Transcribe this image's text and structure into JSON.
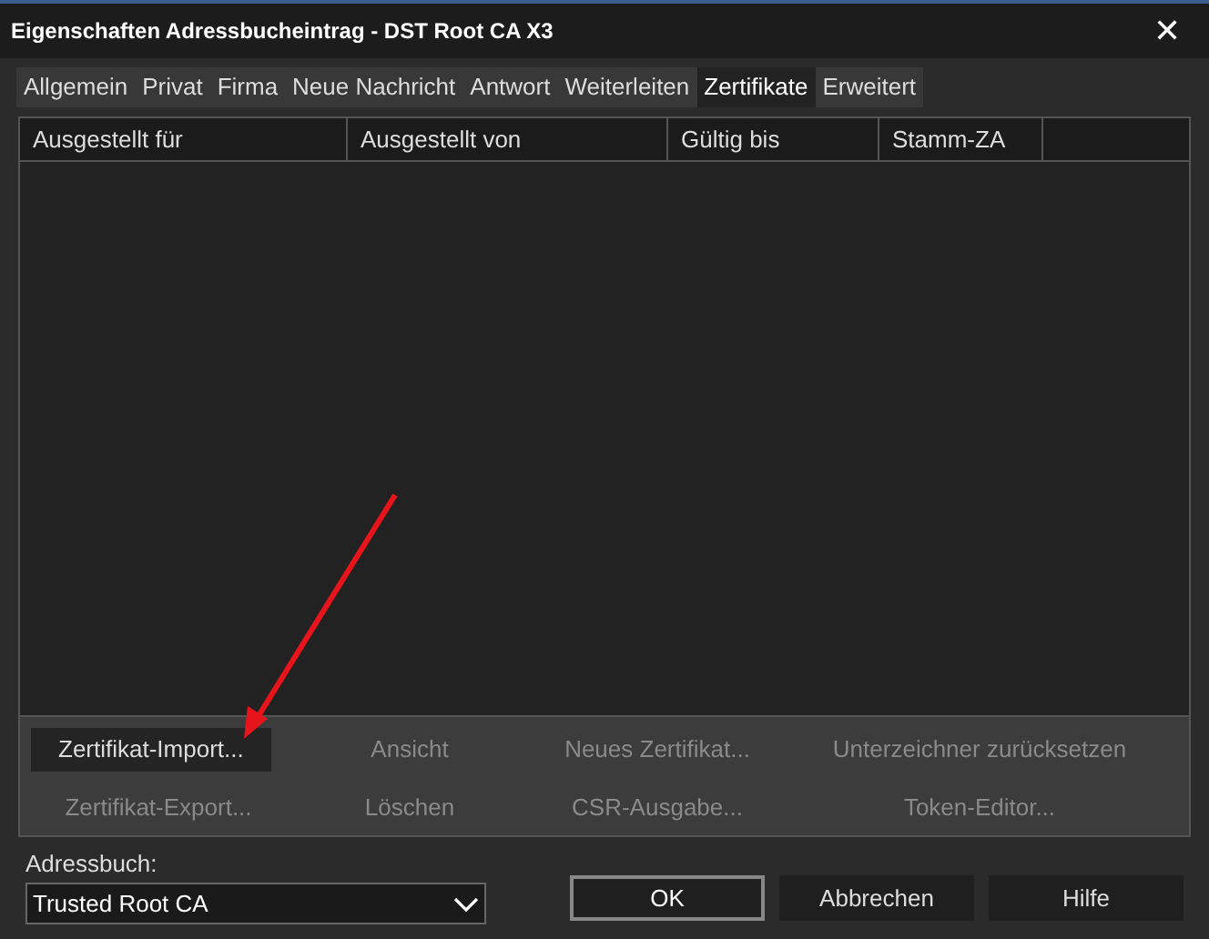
{
  "window": {
    "title": "Eigenschaften Adressbucheintrag - DST Root CA X3",
    "close": "✕"
  },
  "tabs": [
    {
      "label": "Allgemein",
      "selected": false
    },
    {
      "label": "Privat",
      "selected": false
    },
    {
      "label": "Firma",
      "selected": false
    },
    {
      "label": "Neue Nachricht",
      "selected": false
    },
    {
      "label": "Antwort",
      "selected": false
    },
    {
      "label": "Weiterleiten",
      "selected": false
    },
    {
      "label": "Zertifikate",
      "selected": true
    },
    {
      "label": "Erweitert",
      "selected": false
    }
  ],
  "table": {
    "columns": [
      "Ausgestellt für",
      "Ausgestellt von",
      "Gültig bis",
      "Stamm-ZA"
    ]
  },
  "actions": [
    {
      "label": "Zertifikat-Import...",
      "disabled": false
    },
    {
      "label": "Ansicht",
      "disabled": true
    },
    {
      "label": "Neues Zertifikat...",
      "disabled": true
    },
    {
      "label": "Unterzeichner zurücksetzen",
      "disabled": true
    },
    {
      "label": "Zertifikat-Export...",
      "disabled": true
    },
    {
      "label": "Löschen",
      "disabled": true
    },
    {
      "label": "CSR-Ausgabe...",
      "disabled": true
    },
    {
      "label": "Token-Editor...",
      "disabled": true
    }
  ],
  "address_book": {
    "label": "Adressbuch:",
    "value": "Trusted Root CA"
  },
  "buttons": [
    {
      "label": "OK",
      "default": true
    },
    {
      "label": "Abbrechen",
      "default": false
    },
    {
      "label": "Hilfe",
      "default": false
    }
  ]
}
